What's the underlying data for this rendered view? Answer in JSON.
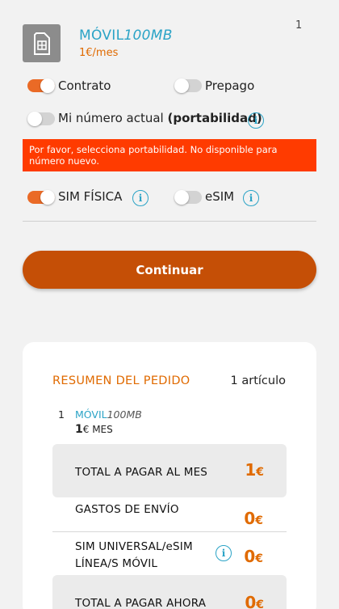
{
  "product": {
    "name_brand": "MÓVIL",
    "name_plan": "100MB",
    "price": "1€/mes",
    "quantity": "1",
    "icon": "sim-card-icon"
  },
  "options": {
    "contrato": {
      "label": "Contrato",
      "on": true
    },
    "prepago": {
      "label": "Prepago",
      "on": false
    },
    "portabilidad": {
      "label_main": "Mi número actual",
      "label_bold": "(portabilidad)",
      "on": false
    },
    "sim_fisica": {
      "label": "SIM FÍSICA",
      "on": true
    },
    "esim": {
      "label": "eSIM",
      "on": false
    }
  },
  "error_message": "Por favor, selecciona portabilidad. No disponible para número nuevo.",
  "continue_label": "Continuar",
  "summary": {
    "title": "RESUMEN DEL PEDIDO",
    "count": "1 artículo",
    "line_number": "1",
    "line_brand": "MÓVIL",
    "line_plan": "100MB",
    "line_price_value": "1",
    "line_price_unit": "€ MES",
    "monthly_label": "TOTAL A PAGAR AL MES",
    "monthly_value": "1",
    "shipping_label": "GASTOS DE ENVÍO",
    "shipping_value": "0",
    "sim_label_1": "SIM UNIVERSAL/eSIM",
    "sim_label_2": "LÍNEA/S MÓVIL",
    "sim_value": "0",
    "now_label": "TOTAL A PAGAR AHORA",
    "now_value": "0",
    "currency": "€"
  },
  "colors": {
    "accent": "#ea6a26",
    "button": "#c54f06",
    "brand_blue": "#2aa3c6",
    "error": "#ff3b00"
  }
}
